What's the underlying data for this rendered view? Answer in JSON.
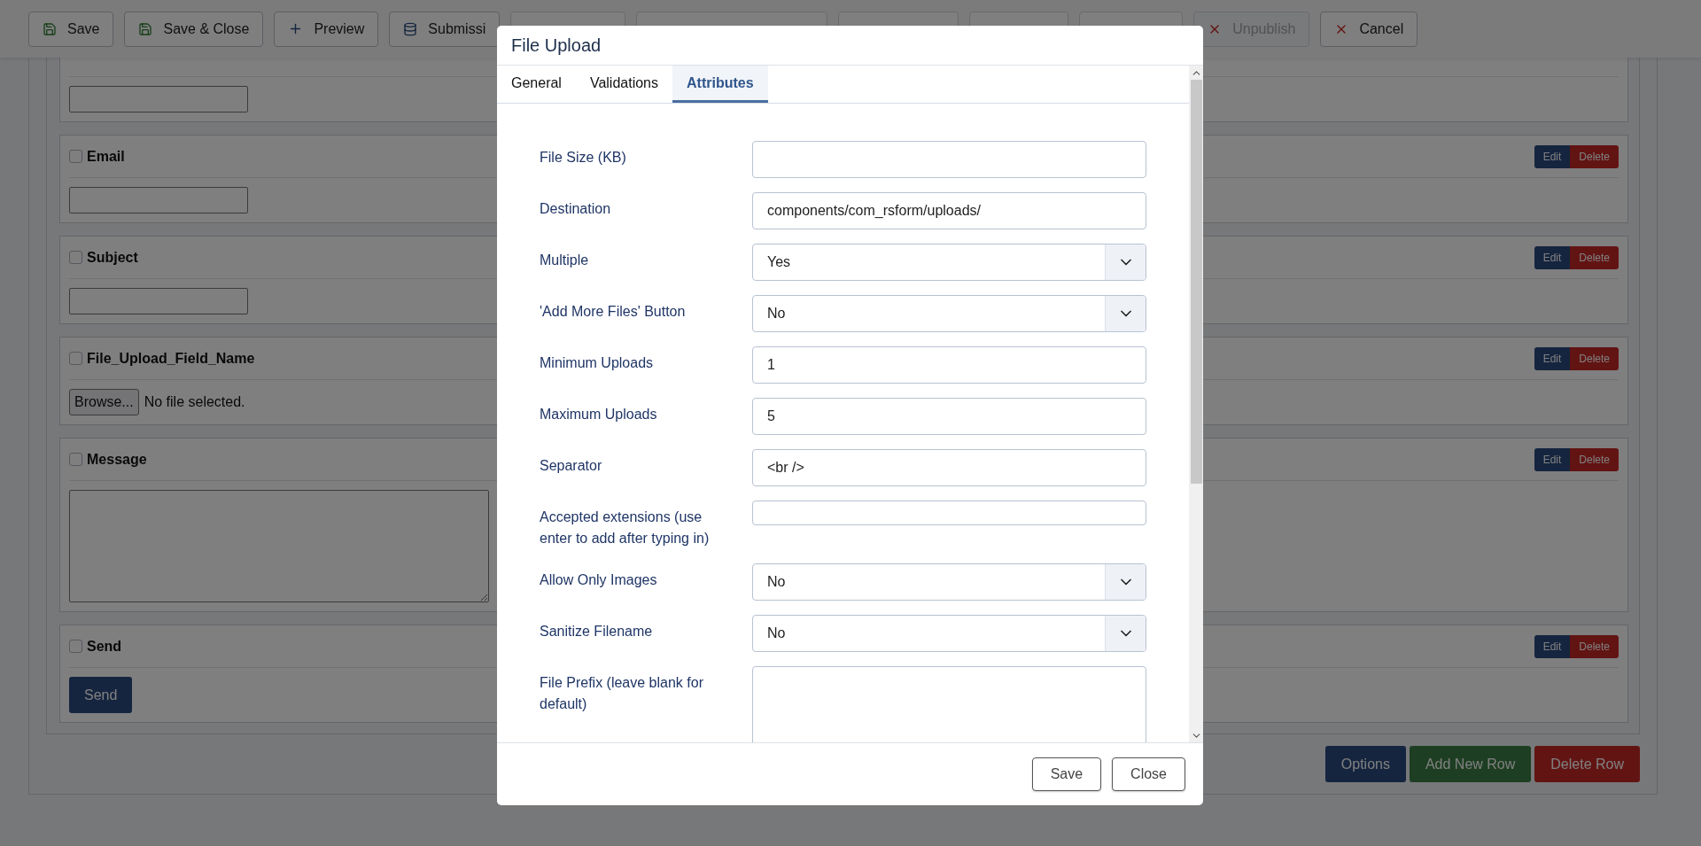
{
  "toolbar": {
    "buttons": [
      {
        "kind": "save",
        "label": "Save",
        "disabled": false
      },
      {
        "kind": "save",
        "label": "Save & Close",
        "disabled": false
      },
      {
        "kind": "add",
        "label": "Preview",
        "disabled": false
      },
      {
        "kind": "data",
        "label": "Submissi",
        "disabled": false
      },
      {
        "kind": "covered"
      },
      {
        "kind": "covered"
      },
      {
        "kind": "covered"
      },
      {
        "kind": "covered"
      },
      {
        "kind": "covered"
      },
      {
        "kind": "remove",
        "label": "Unpublish",
        "disabled": true
      },
      {
        "kind": "remove",
        "label": "Cancel",
        "disabled": false
      }
    ]
  },
  "form_fields": [
    {
      "kind": "text"
    },
    {
      "kind": "text",
      "label": "Email",
      "checked": false,
      "edit": "Edit",
      "delete": "Delete"
    },
    {
      "kind": "text",
      "label": "Subject",
      "checked": false,
      "edit": "Edit",
      "delete": "Delete"
    },
    {
      "kind": "file",
      "label": "File_Upload_Field_Name",
      "checked": false,
      "edit": "Edit",
      "delete": "Delete",
      "browse": "Browse...",
      "file_status": "No file selected."
    },
    {
      "kind": "textarea",
      "label": "Message",
      "checked": false,
      "edit": "Edit",
      "delete": "Delete"
    },
    {
      "kind": "submit",
      "label": "Send",
      "checked": false,
      "edit": "Edit",
      "delete": "Delete",
      "button": "Send"
    }
  ],
  "row_buttons": [
    {
      "label": "Options",
      "kind": "primary"
    },
    {
      "label": "Add New Row",
      "kind": "success"
    },
    {
      "label": "Delete Row",
      "kind": "danger"
    }
  ],
  "modal": {
    "title": "File Upload",
    "tabs": [
      {
        "label": "General",
        "selected": false
      },
      {
        "label": "Validations",
        "selected": false
      },
      {
        "label": "Attributes",
        "selected": true
      }
    ],
    "fields": [
      {
        "label": "File Size (KB)",
        "kind": "text"
      },
      {
        "label": "Destination",
        "kind": "text",
        "value": "components/com_rsform/uploads/"
      },
      {
        "label": "Multiple",
        "kind": "select",
        "value": "Yes"
      },
      {
        "label": "'Add More Files' Button",
        "kind": "select",
        "value": "No"
      },
      {
        "label": "Minimum Uploads",
        "kind": "text",
        "value": "1"
      },
      {
        "label": "Maximum Uploads",
        "kind": "text",
        "value": "5"
      },
      {
        "label": "Separator",
        "kind": "text",
        "value": "<br />"
      },
      {
        "label": "Accepted extensions (use enter to add after typing in)",
        "kind": "tags"
      },
      {
        "label": "Allow Only Images",
        "kind": "select",
        "value": "No"
      },
      {
        "label": "Sanitize Filename",
        "kind": "select",
        "value": "No"
      },
      {
        "label": "File Prefix (leave blank for default)",
        "kind": "textarea"
      }
    ],
    "buttons": [
      "Save",
      "Close"
    ]
  }
}
